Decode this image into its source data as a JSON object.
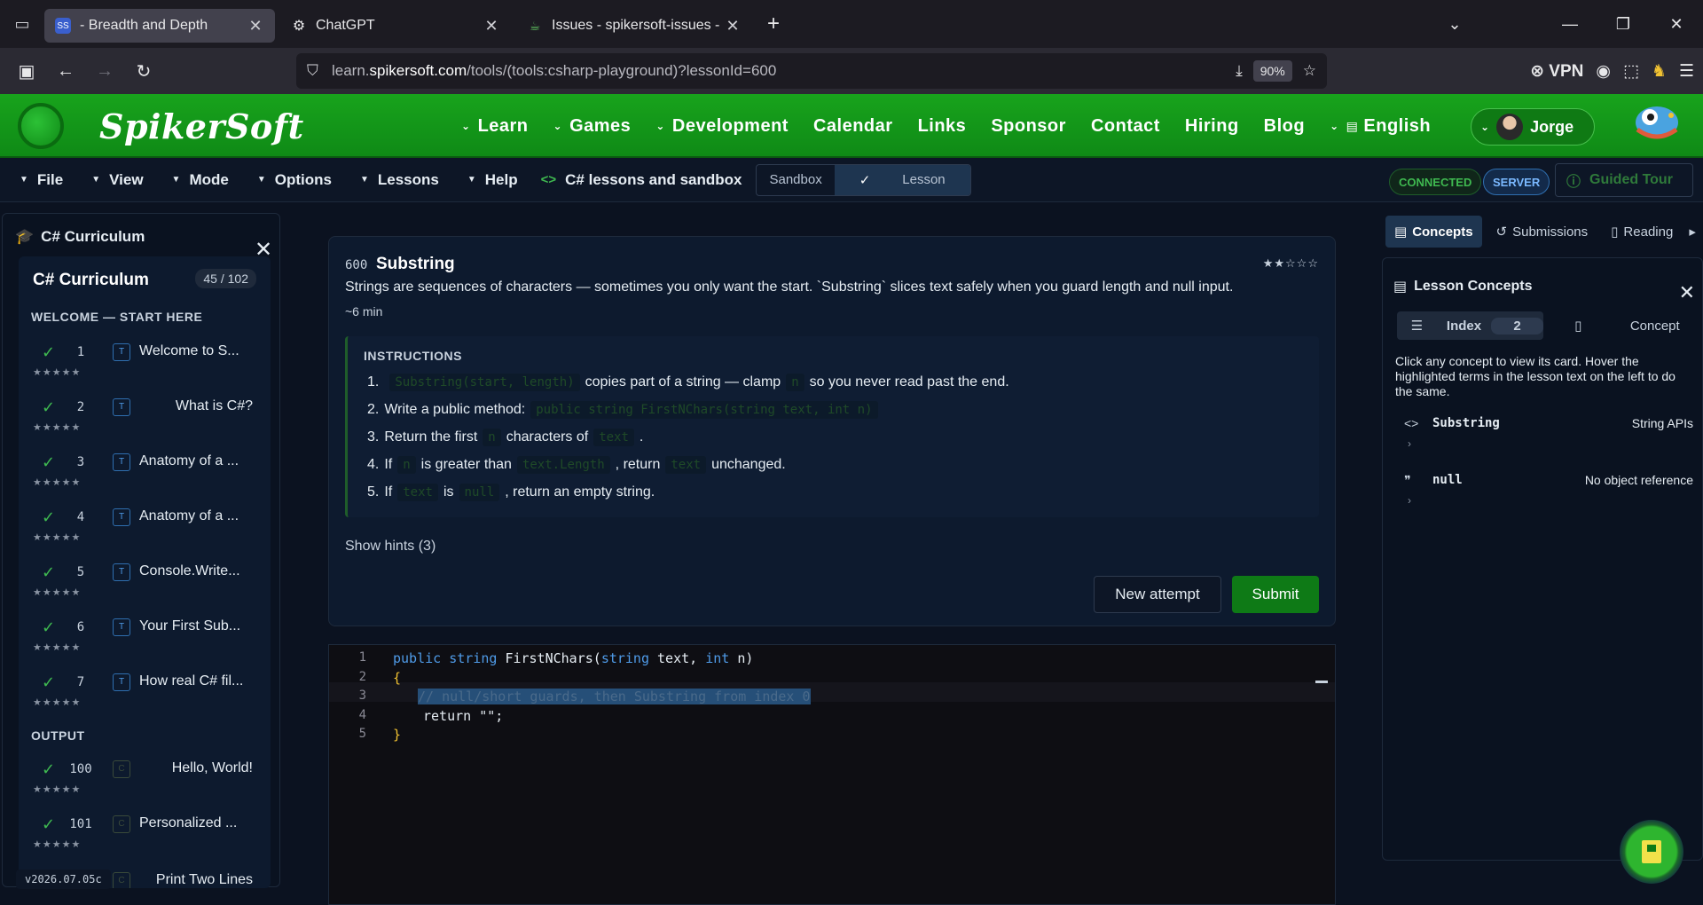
{
  "browser": {
    "tabs": [
      {
        "title": "- Breadth and Depth",
        "active": true,
        "icon": "spikersoft-favicon"
      },
      {
        "title": "ChatGPT",
        "active": false,
        "icon": "chatgpt-favicon"
      },
      {
        "title": "Issues - spikersoft-issues - Gitea",
        "active": false,
        "icon": "gitea-favicon"
      }
    ],
    "url_prefix": "learn.",
    "url_host": "spikersoft.com",
    "url_path": "/tools/(tools:csharp-playground)?lessonId=600",
    "zoom": "90%",
    "vpn_label": "VPN"
  },
  "site": {
    "brand": "SpikerSoft",
    "menu": [
      {
        "label": "Learn",
        "dropdown": true
      },
      {
        "label": "Games",
        "dropdown": true
      },
      {
        "label": "Development",
        "dropdown": true
      },
      {
        "label": "Calendar",
        "dropdown": false
      },
      {
        "label": "Links",
        "dropdown": false
      },
      {
        "label": "Sponsor",
        "dropdown": false
      },
      {
        "label": "Contact",
        "dropdown": false
      },
      {
        "label": "Hiring",
        "dropdown": false
      },
      {
        "label": "Blog",
        "dropdown": false
      },
      {
        "label": "English",
        "dropdown": true
      }
    ],
    "user": "Jorge",
    "accent": "#18a31c"
  },
  "toolbar": {
    "items": [
      "File",
      "View",
      "Mode",
      "Options",
      "Lessons",
      "Help"
    ],
    "breadcrumb": "C# lessons and sandbox",
    "mode_sandbox": "Sandbox",
    "mode_lesson": "Lesson",
    "status_connected": "CONNECTED",
    "status_server": "SERVER",
    "guided_tour": "Guided Tour"
  },
  "sidebar": {
    "header": "C# Curriculum",
    "title": "C# Curriculum",
    "count": "45 / 102",
    "section1": "WELCOME — START HERE",
    "section2": "OUTPUT",
    "lessons": [
      {
        "num": "1",
        "tag": "T",
        "title": "Welcome to S...",
        "stars": "★★★★★"
      },
      {
        "num": "2",
        "tag": "T",
        "title": "What is C#?",
        "stars": "★★★★★"
      },
      {
        "num": "3",
        "tag": "T",
        "title": "Anatomy of a ...",
        "stars": "★★★★★"
      },
      {
        "num": "4",
        "tag": "T",
        "title": "Anatomy of a ...",
        "stars": "★★★★★"
      },
      {
        "num": "5",
        "tag": "T",
        "title": "Console.Write...",
        "stars": "★★★★★"
      },
      {
        "num": "6",
        "tag": "T",
        "title": "Your First Sub...",
        "stars": "★★★★★"
      },
      {
        "num": "7",
        "tag": "T",
        "title": "How real C# fil...",
        "stars": "★★★★★"
      }
    ],
    "output_lessons": [
      {
        "num": "100",
        "tag": "C",
        "title": "Hello, World!",
        "stars": "★★★★★"
      },
      {
        "num": "101",
        "tag": "C",
        "title": "Personalized ...",
        "stars": "★★★★★"
      },
      {
        "num": "",
        "tag": "C",
        "title": "Print Two Lines",
        "stars": ""
      }
    ],
    "version": "v2026.07.05c"
  },
  "lesson": {
    "number": "600",
    "title": "Substring",
    "stars": "★★☆☆☆",
    "description": "Strings are sequences of characters — sometimes you only want the start. `Substring` slices text safely when you guard length and null input.",
    "time": "~6 min",
    "instructions_heading": "INSTRUCTIONS",
    "steps": {
      "s1_code": "Substring(start, length)",
      "s1_text_a": "copies part of a string — clamp",
      "s1_code2": "n",
      "s1_text_b": "so you never read past the end.",
      "s2_text": "Write a public method:",
      "s2_code": "public string FirstNChars(string text, int n)",
      "s3_text_a": "Return the first",
      "s3_code": "n",
      "s3_text_b": "characters of",
      "s3_code2": "text",
      "s3_text_c": ".",
      "s4_text_a": "If",
      "s4_code": "n",
      "s4_text_b": "is greater than",
      "s4_code2": "text.Length",
      "s4_text_c": ", return",
      "s4_code3": "text",
      "s4_text_d": "unchanged.",
      "s5_text_a": "If",
      "s5_code": "text",
      "s5_text_b": "is",
      "s5_code2": "null",
      "s5_text_c": ", return an empty string."
    },
    "hints": "Show hints (3)",
    "new_attempt": "New attempt",
    "submit": "Submit"
  },
  "editor": {
    "line_numbers": [
      "1",
      "2",
      "3",
      "4",
      "5"
    ],
    "l1_kw1": "public",
    "l1_kw2": "string",
    "l1_name": "FirstNChars(",
    "l1_kw3": "string",
    "l1_p1": "text,",
    "l1_kw4": "int",
    "l1_p2": "n)",
    "l2": "{",
    "l3": "// null/short guards, then Substring from index 0",
    "l4": "return \"\";",
    "l5": "}"
  },
  "concepts_panel": {
    "tabs": [
      "Concepts",
      "Submissions",
      "Reading"
    ],
    "header": "Lesson Concepts",
    "seg_index": "Index",
    "seg_index_count": "2",
    "seg_concept": "Concept",
    "help": "Click any concept to view its card. Hover the highlighted terms in the lesson text on the left to do the same.",
    "items": [
      {
        "icon": "code-icon",
        "name": "Substring",
        "desc": "String APIs"
      },
      {
        "icon": "quote-icon",
        "name": "null",
        "desc": "No object reference"
      }
    ]
  }
}
